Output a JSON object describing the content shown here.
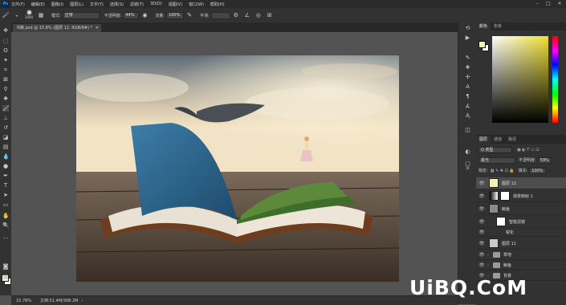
{
  "menubar": {
    "logo": "Ps",
    "items": [
      "文件(F)",
      "编辑(E)",
      "图像(I)",
      "图层(L)",
      "文字(Y)",
      "选择(S)",
      "滤镜(T)",
      "3D(D)",
      "视图(V)",
      "窗口(W)",
      "帮助(H)"
    ]
  },
  "options": {
    "brush_size": "1000",
    "mode_label": "模式:",
    "mode_value": "正常",
    "opacity_label": "不透明度:",
    "opacity_value": "44%",
    "flow_label": "流量:",
    "flow_value": "100%",
    "smooth_label": "平滑:"
  },
  "document": {
    "tab_title": "书籍.psd @ 15.8% (图层 12, RGB/8#) *"
  },
  "status": {
    "zoom": "15.78%",
    "doc_info": "文档:51.4M/308.2M"
  },
  "color_panel": {
    "tabs": [
      "颜色",
      "色板"
    ],
    "fg_color": "#f3f0b8",
    "bg_color": "#ffffff"
  },
  "layers_panel": {
    "tabs": [
      "图层",
      "通道",
      "路径"
    ],
    "filter_kind": "Q 类型",
    "blend_mode": "柔光",
    "opacity_label": "不透明度:",
    "opacity_value": "59%",
    "lock_label": "锁定:",
    "fill_label": "填充:",
    "fill_value": "100%",
    "layers": [
      {
        "name": "图层 12",
        "selected": true,
        "thumb": "#f3f0b8"
      },
      {
        "name": "渐变映射 1",
        "selected": false,
        "thumb": "#ffffff"
      },
      {
        "name": "鲸鱼",
        "selected": false,
        "thumb": "#8a8a8a"
      },
      {
        "name": "智能滤镜",
        "selected": false,
        "thumb": "#ffffff"
      },
      {
        "name": "锐化",
        "selected": false,
        "thumb": ""
      },
      {
        "name": "图层 11",
        "selected": false,
        "thumb": "#c9c9c9"
      },
      {
        "name": "草地",
        "selected": false,
        "thumb": ""
      },
      {
        "name": "鲸鱼",
        "selected": false,
        "thumb": ""
      },
      {
        "name": "背景",
        "selected": false,
        "thumb": ""
      }
    ]
  },
  "watermark": "UiBQ.CoM"
}
